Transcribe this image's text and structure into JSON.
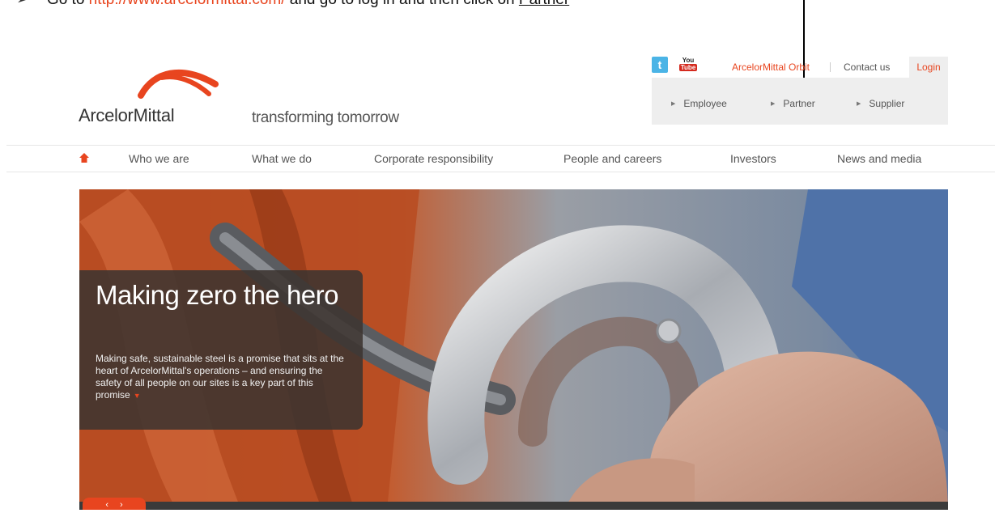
{
  "instruction": {
    "bullet": "➢",
    "prefix": "Go to ",
    "url": "http://www.arcelormittal.com/",
    "middle": " and go to log in and then click on ",
    "target": "Partner"
  },
  "brand": {
    "name": "ArcelorMittal",
    "tagline": "transforming tomorrow",
    "accent_color": "#e8451f"
  },
  "utility_bar": {
    "twitter_icon": "twitter-icon",
    "youtube_icon": "youtube-icon",
    "youtube_top": "You",
    "youtube_bottom": "Tube",
    "orbit": "ArcelorMittal Orbit",
    "contact": "Contact us",
    "login": "Login"
  },
  "login_panel": {
    "options": [
      {
        "label": "Employee"
      },
      {
        "label": "Partner"
      },
      {
        "label": "Supplier"
      }
    ]
  },
  "nav": {
    "home_icon": "home-icon",
    "items": [
      {
        "label": "Who we are"
      },
      {
        "label": "What we do"
      },
      {
        "label": "Corporate responsibility"
      },
      {
        "label": "People and careers"
      },
      {
        "label": "Investors"
      },
      {
        "label": "News and media"
      }
    ]
  },
  "hero": {
    "title": "Making zero the hero",
    "body": "Making safe, sustainable steel is a promise that sits at the heart of ArcelorMittal's operations – and ensuring the safety of all people on our sites is a key part of this promise",
    "more_icon": "▼",
    "prev": "‹",
    "next": "›"
  }
}
